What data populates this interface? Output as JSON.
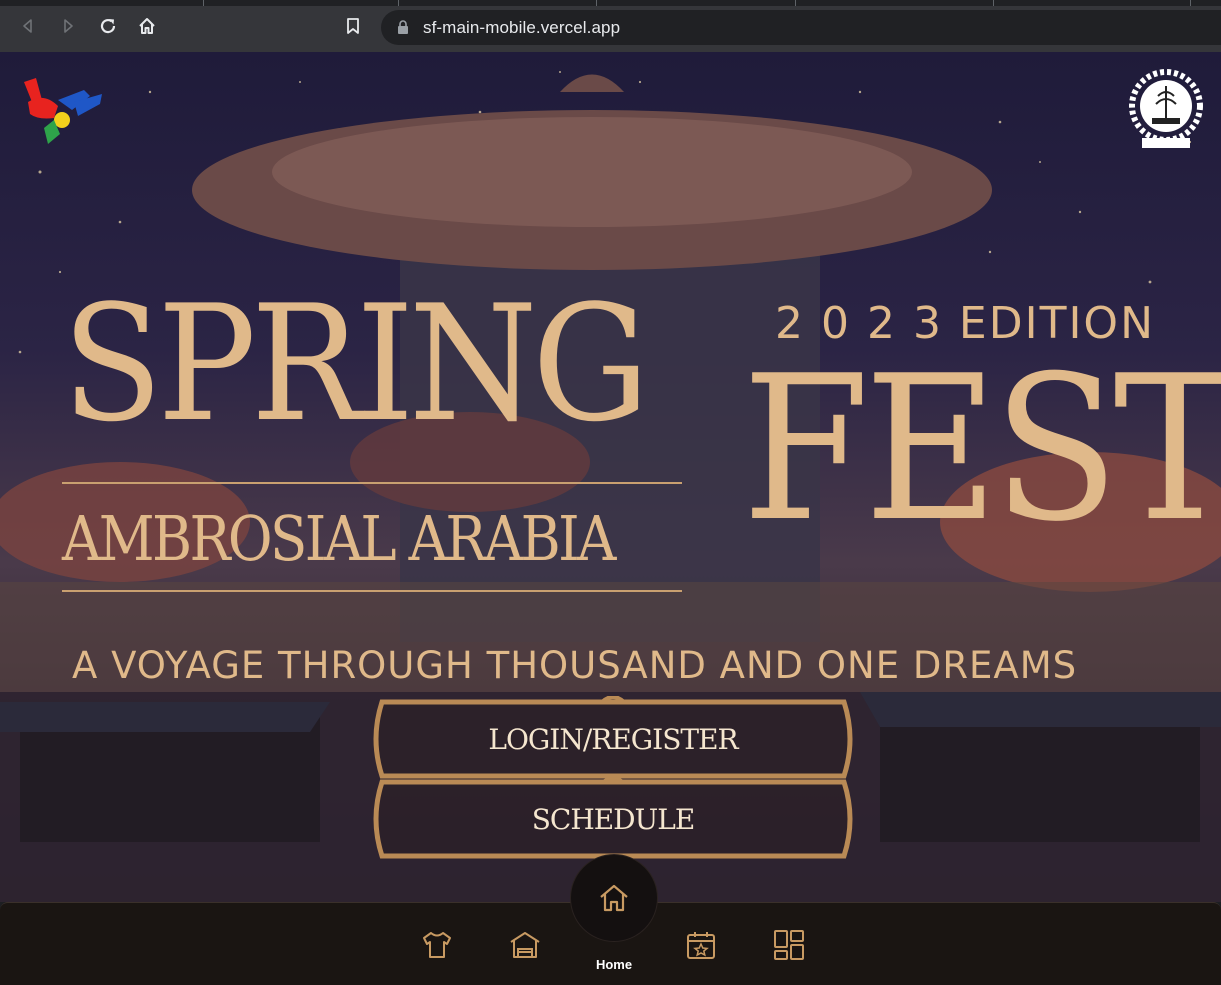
{
  "browser": {
    "url": "sf-main-mobile.vercel.app",
    "icons": [
      "back-icon",
      "forward-icon",
      "reload-icon",
      "home-icon",
      "bookmark-icon",
      "lock-icon"
    ]
  },
  "hero": {
    "title_line1": "SPRING",
    "edition": "2 0 2 3 EDITION",
    "title_line2": "FEST",
    "theme": "AMBROSIAL ARABIA",
    "tagline": "A VOYAGE THROUGH THOUSAND AND ONE DREAMS",
    "logos": [
      "spring-fest-hands-logo",
      "iit-kharagpur-logo"
    ]
  },
  "actions": {
    "login_label": "LOGIN/REGISTER",
    "schedule_label": "SCHEDULE"
  },
  "bottom_nav": {
    "home_label": "Home",
    "items": [
      {
        "icon": "tshirt-icon"
      },
      {
        "icon": "accommodation-icon"
      },
      {
        "icon": "home-icon"
      },
      {
        "icon": "calendar-star-icon"
      },
      {
        "icon": "dashboard-icon"
      }
    ]
  },
  "colors": {
    "gold": "#e0b98a",
    "button_border": "#b98a55",
    "chrome": "#35363a"
  }
}
